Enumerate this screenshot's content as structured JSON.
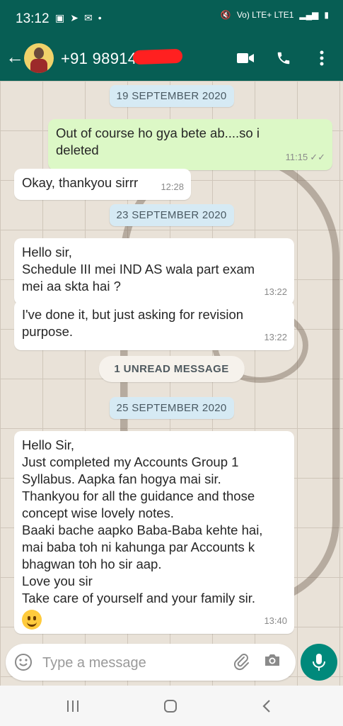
{
  "status": {
    "time": "13:12",
    "network_label": "Vo) LTE+ LTE1"
  },
  "header": {
    "contact": "+91 98914"
  },
  "chat": {
    "dates": [
      "19 SEPTEMBER 2020",
      "23 SEPTEMBER 2020",
      "25 SEPTEMBER 2020"
    ],
    "messages": [
      {
        "direction": "out",
        "lines": [
          "Out of course ho gya bete ab....so i",
          "deleted"
        ],
        "time": "11:15",
        "ticks": "✓✓"
      },
      {
        "direction": "in",
        "lines": [
          "Okay, thankyou sirrr"
        ],
        "time": "12:28"
      },
      {
        "direction": "in",
        "lines": [
          "Hello sir,",
          "Schedule III mei IND AS wala part exam",
          "mei aa skta hai ?"
        ],
        "time": "13:22"
      },
      {
        "direction": "in",
        "lines": [
          "I've done it, but just asking for revision",
          "purpose."
        ],
        "time": "13:22"
      },
      {
        "direction": "in",
        "lines": [
          "Hello Sir,",
          "Just completed my Accounts Group 1",
          "Syllabus. Aapka fan hogya mai sir.",
          "Thankyou for all the guidance and those",
          "concept wise lovely notes.",
          "Baaki bache aapko Baba-Baba kehte hai,",
          "mai baba toh ni kahunga par Accounts k",
          "bhagwan toh ho sir aap.",
          "Love you sir",
          "Take care of yourself and your family sir."
        ],
        "time": "13:40",
        "emoji": "smiling-face"
      }
    ],
    "unread_label": "1 UNREAD MESSAGE"
  },
  "composer": {
    "placeholder": "Type a message"
  },
  "colors": {
    "header": "#075e54",
    "outgoing": "#dcf8c6",
    "incoming": "#ffffff",
    "mic": "#00897b"
  }
}
